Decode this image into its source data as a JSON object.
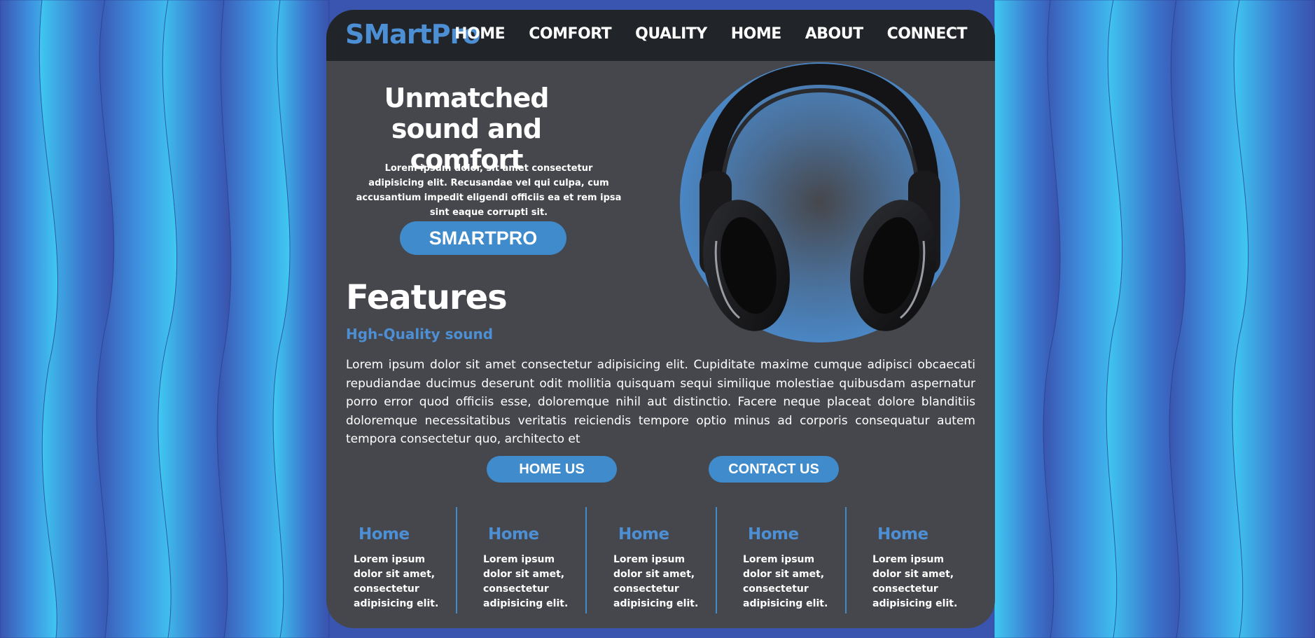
{
  "colors": {
    "accent": "#4c8fd4",
    "button": "#3f8bcb",
    "card": "#46474c",
    "navbar": "#212428",
    "background_wave_light": "#3ec8f2",
    "background_wave_dark": "#3a55b0"
  },
  "header": {
    "logo": "SMartPro",
    "nav": [
      "HOME",
      "COMFORT",
      "QUALITY",
      "HOME",
      "ABOUT",
      "CONNECT"
    ]
  },
  "hero": {
    "title": "Unmatched sound and comfort",
    "text": "Lorem ipsum dolor, sit amet consectetur adipisicing elit. Recusandae vel qui culpa, cum accusantium impedit eligendi officiis ea et rem ipsa sint eaque corrupti sit.",
    "button": "SMARTPRO",
    "image_icon": "headphones-icon"
  },
  "features": {
    "title": "Features",
    "subtitle": "Hgh-Quality sound",
    "text": "Lorem ipsum dolor sit amet consectetur adipisicing elit. Cupiditate maxime cumque adipisci obcaecati repudiandae ducimus deserunt odit mollitia quisquam sequi similique molestiae quibusdam aspernatur porro error quod officiis esse, doloremque nihil aut distinctio. Facere neque placeat dolore blanditiis doloremque necessitatibus veritatis reiciendis tempore optio minus ad corporis consequatur autem tempora consectetur quo, architecto et",
    "home_button": "HOME US",
    "contact_button": "CONTACT US"
  },
  "footer": {
    "columns": [
      {
        "title": "Home",
        "text": "Lorem ipsum dolor sit amet, consectetur adipisicing elit."
      },
      {
        "title": "Home",
        "text": "Lorem ipsum dolor sit amet, consectetur adipisicing elit."
      },
      {
        "title": "Home",
        "text": "Lorem ipsum dolor sit amet, consectetur adipisicing elit."
      },
      {
        "title": "Home",
        "text": "Lorem ipsum dolor sit amet, consectetur adipisicing elit."
      },
      {
        "title": "Home",
        "text": "Lorem ipsum dolor sit amet, consectetur adipisicing elit."
      }
    ]
  }
}
